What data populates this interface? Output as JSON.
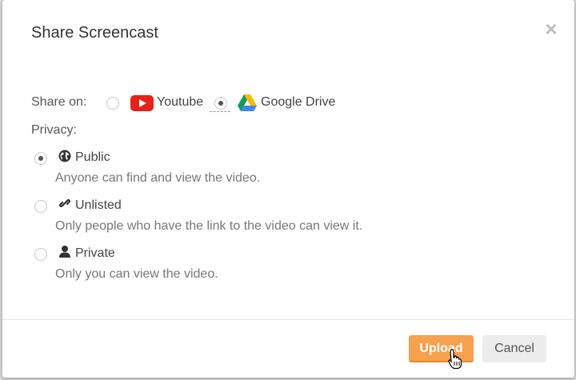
{
  "dialog": {
    "title": "Share Screencast",
    "close_label": "×"
  },
  "share_on": {
    "label": "Share on:",
    "options": [
      {
        "label": "Youtube",
        "icon": "youtube-icon",
        "selected": false
      },
      {
        "label": "Google Drive",
        "icon": "google-drive-icon",
        "selected": true
      }
    ]
  },
  "privacy": {
    "label": "Privacy:",
    "options": [
      {
        "label": "Public",
        "icon": "globe-icon",
        "description": "Anyone can find and view the video.",
        "selected": true
      },
      {
        "label": "Unlisted",
        "icon": "link-icon",
        "description": "Only people who have the link to the video can view it.",
        "selected": false
      },
      {
        "label": "Private",
        "icon": "person-icon",
        "description": "Only you can view the video.",
        "selected": false
      }
    ]
  },
  "footer": {
    "upload_label": "Upload",
    "cancel_label": "Cancel"
  },
  "colors": {
    "upload_button": "#f6a14c",
    "cancel_button": "#ececec",
    "youtube_red": "#e62117"
  }
}
